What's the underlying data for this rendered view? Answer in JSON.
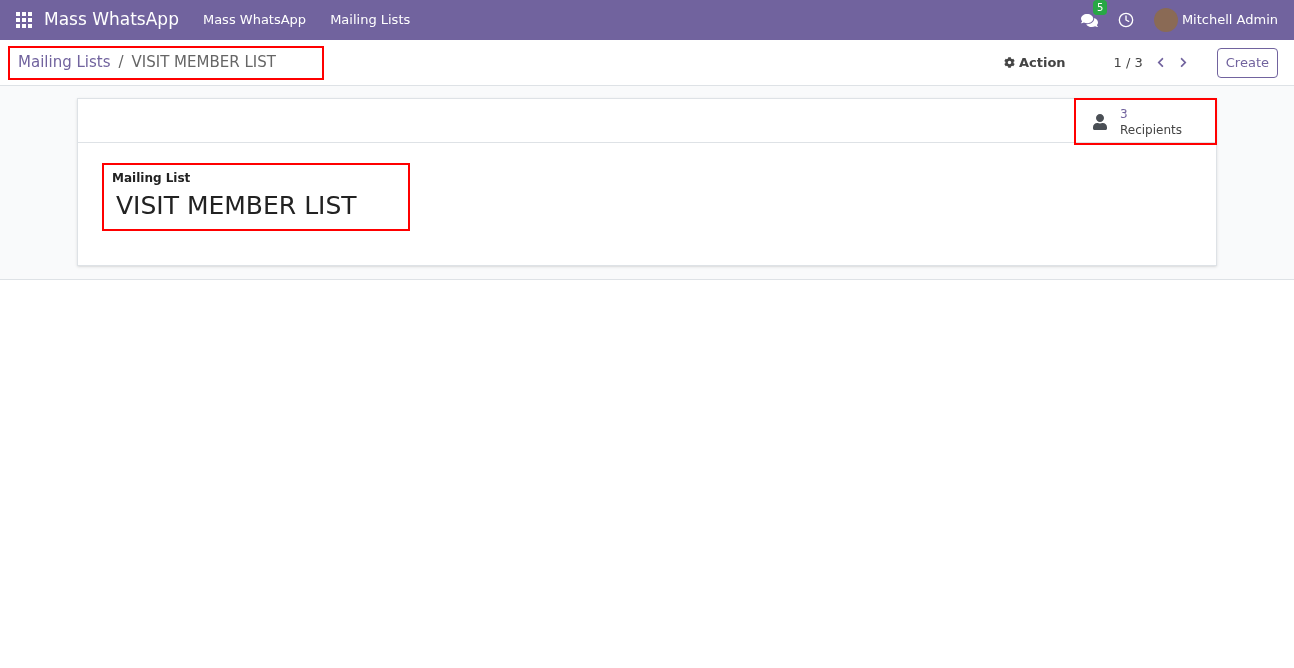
{
  "navbar": {
    "app_name": "Mass WhatsApp",
    "menu": [
      "Mass WhatsApp",
      "Mailing Lists"
    ],
    "messages_badge": "5",
    "user": "Mitchell Admin"
  },
  "control_panel": {
    "breadcrumb": {
      "highlighted": true,
      "parent": "Mailing Lists",
      "separator": "/",
      "current": "VISIT MEMBER LIST"
    },
    "action": "Action",
    "pager": "1 / 3",
    "create": "Create"
  },
  "form": {
    "stat_button": {
      "highlighted": true,
      "value": "3",
      "label": "Recipients"
    },
    "title_field": {
      "highlighted": true,
      "label": "Mailing List",
      "value": "VISIT MEMBER LIST"
    }
  }
}
